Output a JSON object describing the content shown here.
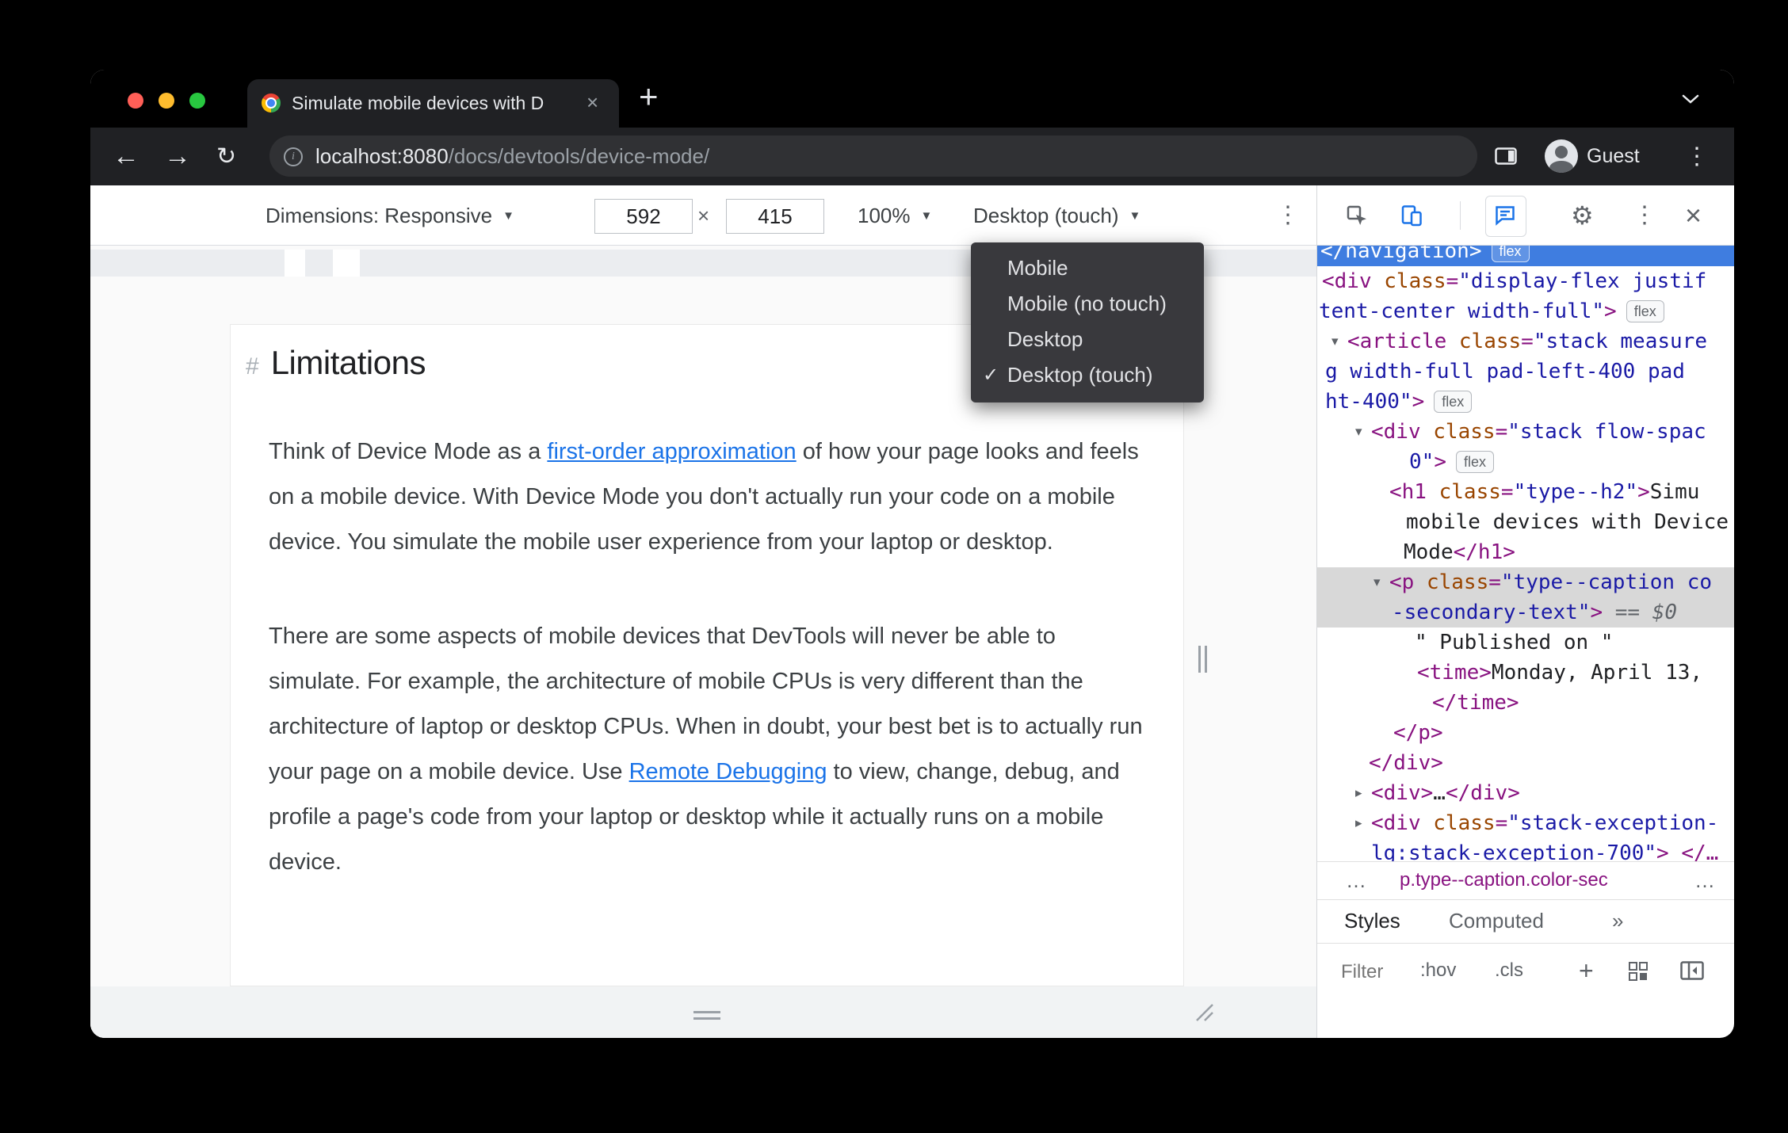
{
  "colors": {
    "accent_blue": "#1a73e8",
    "selection_blue": "#3f7de0",
    "selection_gray": "#d8d8d8",
    "tag": "#881280",
    "attr_name": "#994500",
    "attr_value": "#1a1aa6"
  },
  "icons": {
    "back": "←",
    "forward": "→",
    "reload": "↻",
    "menu": "⋮",
    "close": "×",
    "gear": "⚙",
    "caret": "▼",
    "info": "i"
  },
  "browser": {
    "tab_title": "Simulate mobile devices with D",
    "new_tab": "+",
    "url_host": "localhost:8080",
    "url_path": "/docs/devtools/device-mode/",
    "guest": "Guest"
  },
  "device_toolbar": {
    "dimensions_label": "Dimensions: Responsive",
    "width": "592",
    "times": "×",
    "height": "415",
    "zoom": "100%",
    "device_type": "Desktop (touch)"
  },
  "device_menu": {
    "check": "✓",
    "items": [
      {
        "label": "Mobile",
        "checked": false
      },
      {
        "label": "Mobile (no touch)",
        "checked": false
      },
      {
        "label": "Desktop",
        "checked": false
      },
      {
        "label": "Desktop (touch)",
        "checked": true
      }
    ]
  },
  "article": {
    "hash": "#",
    "title": "Limitations",
    "paragraphs": [
      [
        {
          "t": "Think of Device Mode as a "
        },
        {
          "t": "first-order approximation",
          "link": true
        },
        {
          "t": " of how your page looks and feels on a mobile device. With Device Mode you don't actually run your code on a mobile device. You simulate the mobile user experience from your laptop or desktop."
        }
      ],
      [
        {
          "t": "There are some aspects of mobile devices that DevTools will never be able to simulate. For example, the architecture of mobile CPUs is very different than the architecture of laptop or desktop CPUs. When in doubt, your best bet is to actually run your page on a mobile device. Use "
        },
        {
          "t": "Remote Debugging",
          "link": true
        },
        {
          "t": " to view, change, debug, and profile a page's code from your laptop or desktop while it actually runs on a mobile device."
        }
      ]
    ]
  },
  "devtools": {
    "tree": [
      {
        "indent": 4,
        "bg": "blue",
        "first": true,
        "tokens": [
          {
            "c": "wht",
            "t": "</navigation>"
          },
          {
            "c": "badge",
            "t": "flex"
          }
        ]
      },
      {
        "indent": 6,
        "tokens": [
          {
            "c": "tag",
            "t": "<div "
          },
          {
            "c": "attr",
            "t": "class"
          },
          {
            "c": "tag",
            "t": "="
          },
          {
            "c": "val",
            "t": "\"display-flex justif"
          }
        ]
      },
      {
        "indent": 2,
        "tokens": [
          {
            "c": "val",
            "t": "tent-center width-full\""
          },
          {
            "c": "tag",
            "t": ">"
          },
          {
            "c": "badge",
            "t": "flex"
          }
        ]
      },
      {
        "indent": 38,
        "arrow": "down",
        "arrowX": 18,
        "tokens": [
          {
            "c": "tag",
            "t": "<article "
          },
          {
            "c": "attr",
            "t": "class"
          },
          {
            "c": "tag",
            "t": "="
          },
          {
            "c": "val",
            "t": "\"stack measure"
          }
        ]
      },
      {
        "indent": 10,
        "tokens": [
          {
            "c": "val",
            "t": "g width-full pad-left-400 pad"
          }
        ]
      },
      {
        "indent": 10,
        "tokens": [
          {
            "c": "val",
            "t": "ht-400\""
          },
          {
            "c": "tag",
            "t": ">"
          },
          {
            "c": "badge",
            "t": "flex"
          }
        ]
      },
      {
        "indent": 68,
        "arrow": "down",
        "arrowX": 48,
        "tokens": [
          {
            "c": "tag",
            "t": "<div "
          },
          {
            "c": "attr",
            "t": "class"
          },
          {
            "c": "tag",
            "t": "="
          },
          {
            "c": "val",
            "t": "\"stack flow-spac"
          }
        ]
      },
      {
        "indent": 116,
        "tokens": [
          {
            "c": "val",
            "t": "0\""
          },
          {
            "c": "tag",
            "t": ">"
          },
          {
            "c": "badge",
            "t": "flex"
          }
        ]
      },
      {
        "indent": 91,
        "tokens": [
          {
            "c": "tag",
            "t": "<h1 "
          },
          {
            "c": "attr",
            "t": "class"
          },
          {
            "c": "tag",
            "t": "="
          },
          {
            "c": "val",
            "t": "\"type--h2\""
          },
          {
            "c": "tag",
            "t": ">"
          },
          {
            "c": "txt",
            "t": "Simu"
          }
        ]
      },
      {
        "indent": 112,
        "tokens": [
          {
            "c": "txt",
            "t": "mobile devices with Device"
          }
        ]
      },
      {
        "indent": 109,
        "tokens": [
          {
            "c": "txt",
            "t": "Mode"
          },
          {
            "c": "tag",
            "t": "</h1>"
          }
        ]
      },
      {
        "indent": 91,
        "bg": "gray",
        "arrow": "down",
        "arrowX": 71,
        "tokens": [
          {
            "c": "tag",
            "t": "<p "
          },
          {
            "c": "attr",
            "t": "class"
          },
          {
            "c": "tag",
            "t": "="
          },
          {
            "c": "val",
            "t": "\"type--caption co"
          }
        ]
      },
      {
        "indent": 94,
        "bg": "gray",
        "tokens": [
          {
            "c": "val",
            "t": "-secondary-text\""
          },
          {
            "c": "tag",
            "t": ">"
          },
          {
            "c": "gray",
            "t": " == $0"
          }
        ]
      },
      {
        "indent": 123,
        "tokens": [
          {
            "c": "txt",
            "t": "\" Published on \""
          }
        ]
      },
      {
        "indent": 126,
        "tokens": [
          {
            "c": "tag",
            "t": "<time>"
          },
          {
            "c": "txt",
            "t": "Monday, April 13,"
          }
        ]
      },
      {
        "indent": 145,
        "tokens": [
          {
            "c": "tag",
            "t": "</time>"
          }
        ]
      },
      {
        "indent": 96,
        "tokens": [
          {
            "c": "tag",
            "t": "</p>"
          }
        ]
      },
      {
        "indent": 65,
        "tokens": [
          {
            "c": "tag",
            "t": "</div>"
          }
        ]
      },
      {
        "indent": 68,
        "arrow": "right",
        "arrowX": 48,
        "tokens": [
          {
            "c": "tag",
            "t": "<div>"
          },
          {
            "c": "txt",
            "t": "…"
          },
          {
            "c": "tag",
            "t": "</div>"
          }
        ]
      },
      {
        "indent": 68,
        "arrow": "right",
        "arrowX": 48,
        "tokens": [
          {
            "c": "tag",
            "t": "<div "
          },
          {
            "c": "attr",
            "t": "class"
          },
          {
            "c": "tag",
            "t": "="
          },
          {
            "c": "val",
            "t": "\"stack-exception-"
          }
        ]
      },
      {
        "indent": 68,
        "tokens": [
          {
            "c": "val",
            "t": "lg:stack-exception-700\""
          },
          {
            "c": "tag",
            "t": "> "
          },
          {
            "c": "tag",
            "t": "</…"
          }
        ]
      }
    ],
    "breadcrumb": {
      "left": "…",
      "crumb": "p.type--caption.color-sec",
      "right": "…"
    },
    "tabs": {
      "styles": "Styles",
      "computed": "Computed",
      "more": "»"
    },
    "filter": {
      "placeholder": "Filter",
      "hov": ":hov",
      "cls": ".cls",
      "plus": "+"
    }
  }
}
